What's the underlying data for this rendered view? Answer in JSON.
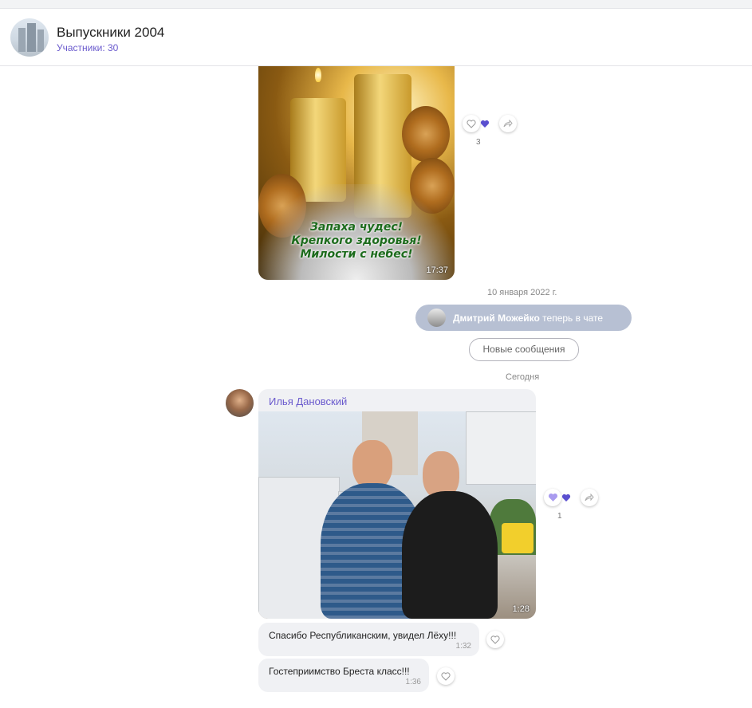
{
  "header": {
    "title": "Выпускники 2004",
    "members": "Участники: 30"
  },
  "message1": {
    "greeting_lines": [
      "Запаха чудес!",
      "Крепкого здоровья!",
      "Милости с небес!"
    ],
    "time": "17:37",
    "reaction_count": "3"
  },
  "separators": {
    "date": "10 января 2022 г.",
    "today": "Сегодня"
  },
  "system": {
    "user": "Дмитрий Можейко",
    "text": " теперь в чате"
  },
  "new_messages": "Новые сообщения",
  "message2": {
    "author": "Илья Дановский",
    "time": "1:28",
    "reaction_count": "1"
  },
  "message3": {
    "text": "Спасибо Республиканским, увидел Лёху!!!",
    "time": "1:32"
  },
  "message4": {
    "text": "Гостеприимство Бреста класс!!!",
    "time": "1:36"
  },
  "colors": {
    "accent": "#6a5acd",
    "heart": "#5a4fcf",
    "pill": "#b7c0d3"
  }
}
